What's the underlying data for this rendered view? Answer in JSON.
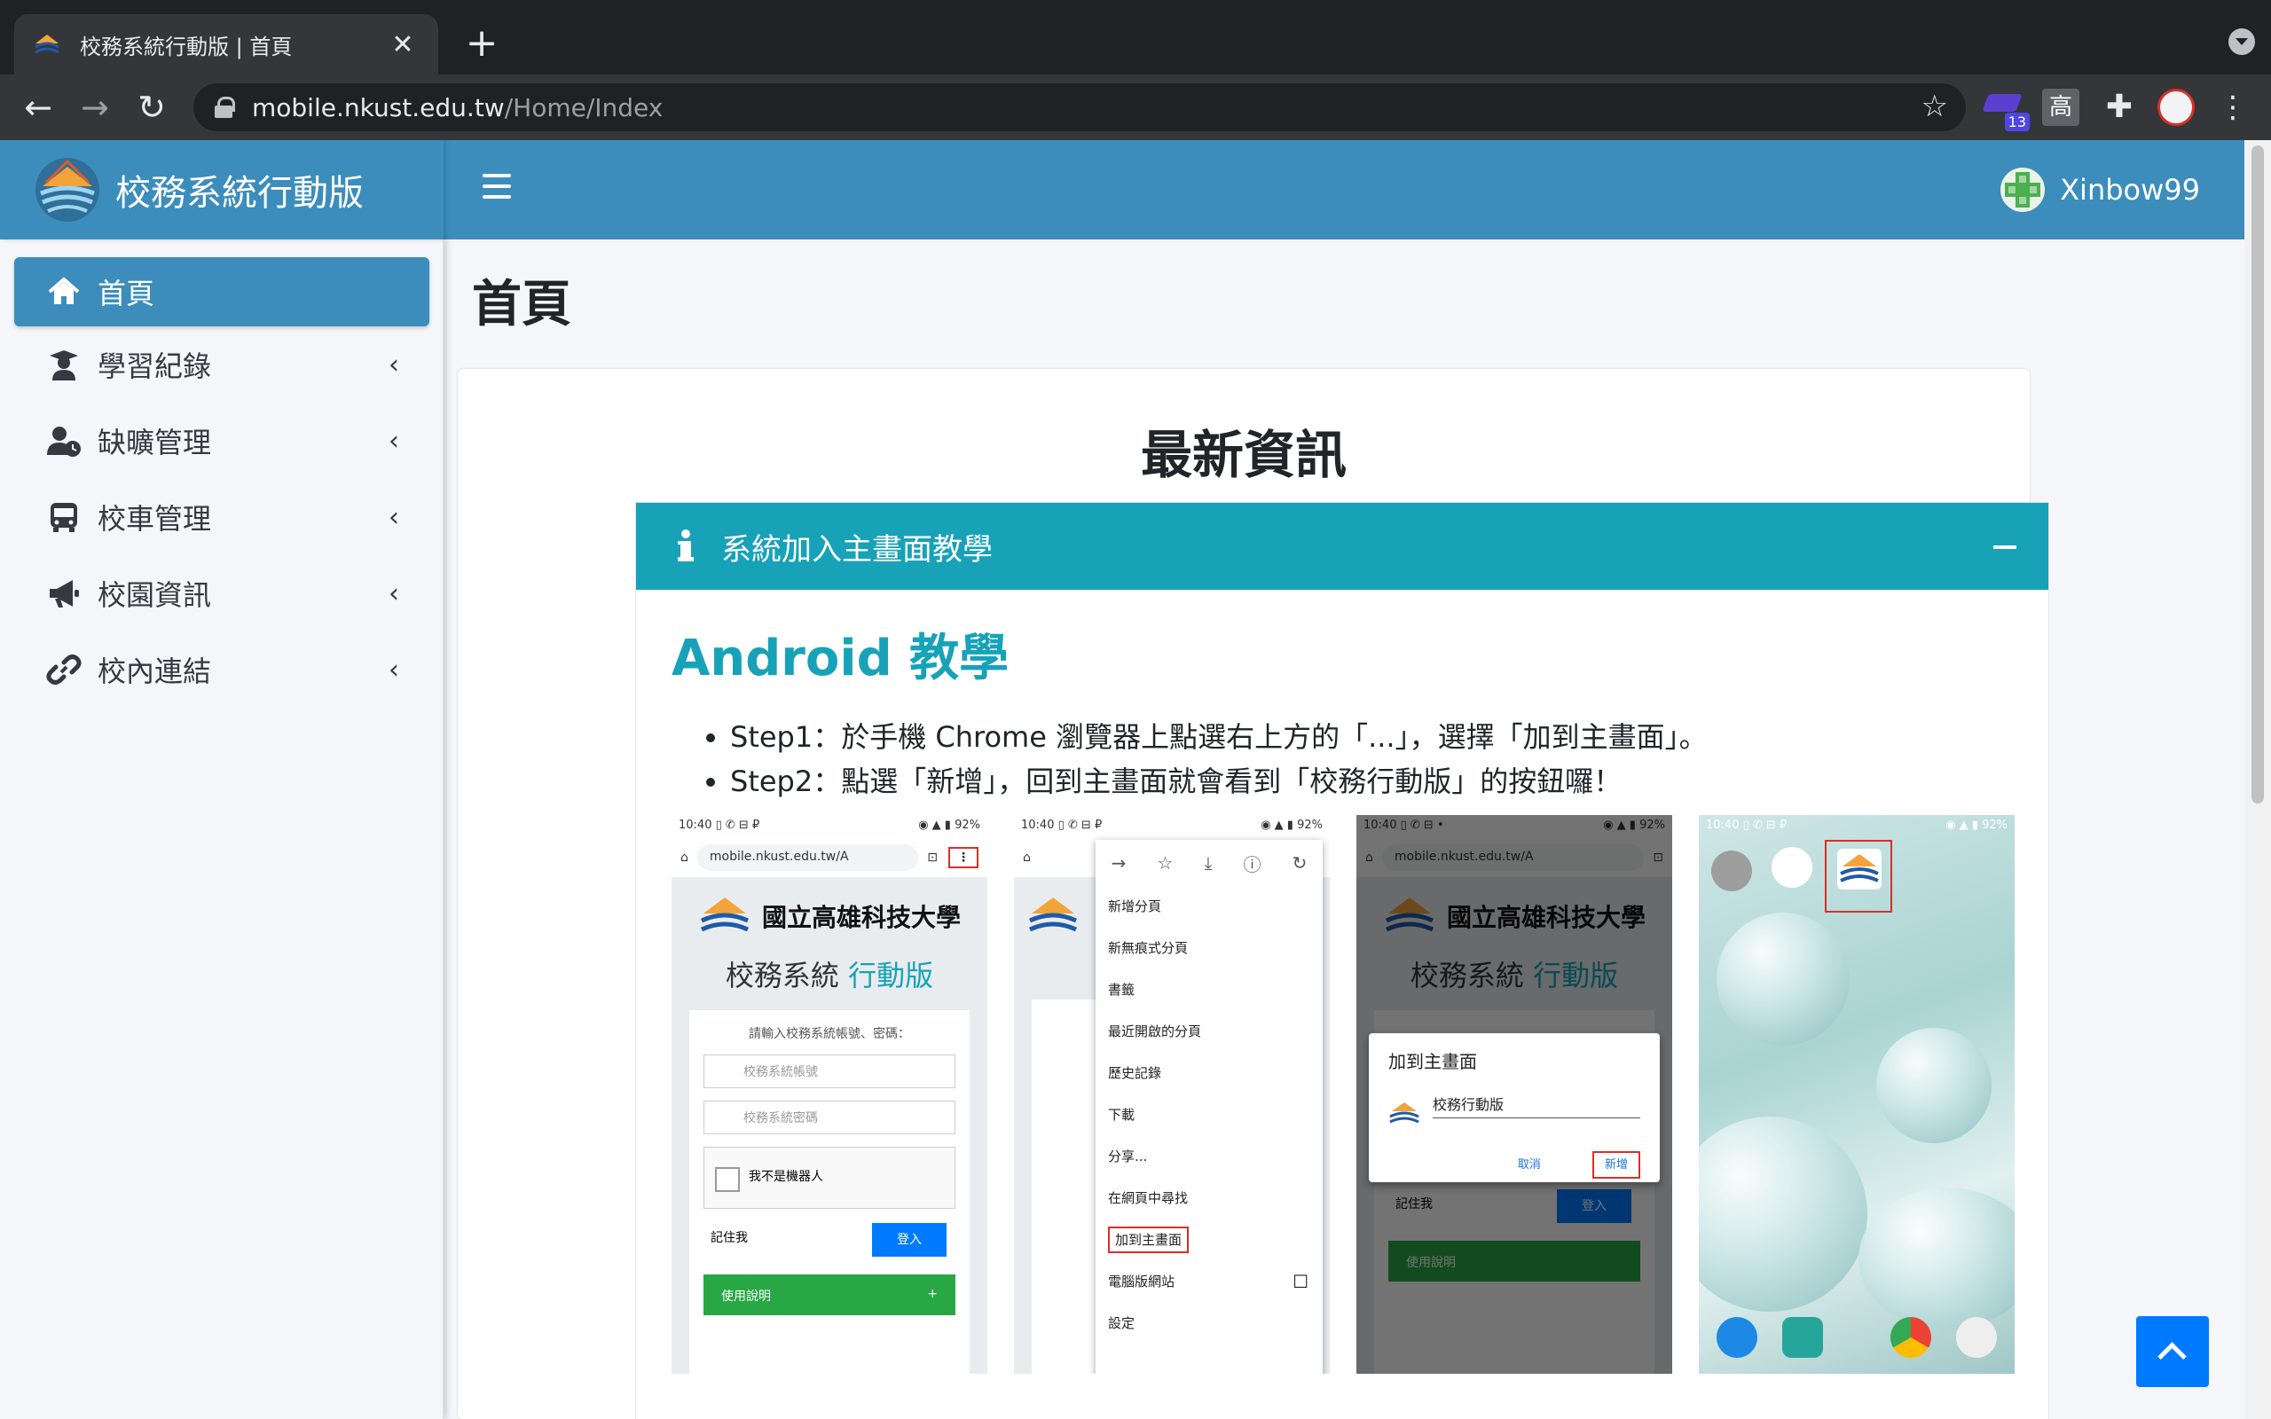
{
  "browser": {
    "tab_title": "校務系統行動版 | 首頁",
    "close_glyph": "✕",
    "new_tab_glyph": "+",
    "url_host": "mobile.nkust.edu.tw",
    "url_path": "/Home/Index",
    "ext_badge_count": "13",
    "ext_gao_label": "高",
    "back_glyph": "←",
    "forward_glyph": "→",
    "reload_glyph": "↻",
    "star_glyph": "☆",
    "menu_glyph": "⋮",
    "puzzle_glyph": "✚"
  },
  "app": {
    "brand": "校務系統行動版",
    "username": "Xinbow99",
    "accent": "#3c8dbc",
    "info_color": "#17a2b8"
  },
  "sidebar": {
    "items": [
      {
        "label": "首頁",
        "icon": "home-icon",
        "active": true
      },
      {
        "label": "學習紀錄",
        "icon": "graduate-icon"
      },
      {
        "label": "缺曠管理",
        "icon": "user-clock-icon"
      },
      {
        "label": "校車管理",
        "icon": "bus-icon"
      },
      {
        "label": "校園資訊",
        "icon": "megaphone-icon"
      },
      {
        "label": "校內連結",
        "icon": "link-icon"
      }
    ],
    "chevron": "‹"
  },
  "main": {
    "page_title": "首頁",
    "card_heading": "最新資訊",
    "panel_title": "系統加入主畫面教學",
    "android_title": "Android 教學",
    "steps": [
      "Step1：於手機 Chrome 瀏覽器上點選右上方的「...」，選擇「加到主畫面」。",
      "Step2：點選「新增」，回到主畫面就會看到「校務行動版」的按鈕囉！"
    ]
  },
  "screenshots": {
    "status_time": "10:40",
    "status_battery": "92%",
    "status_icons_left": "▯ ✆ ⊟ ₽",
    "status_icons_left_alt": "▯ ✆ ⊟ •",
    "status_icons_right": "◉ ▲ ▮",
    "home_glyph": "⌂",
    "tabs_glyph": "⊡",
    "mobile_url": "mobile.nkust.edu.tw/A",
    "school_name": "國立高雄科技大學",
    "system_name": "校務系統",
    "system_name_accent": "行動版",
    "login_hint": "請輸入校務系統帳號、密碼：",
    "account_placeholder": "校務系統帳號",
    "password_placeholder": "校務系統密碼",
    "captcha_label": "我不是機器人",
    "remember_label": "記住我",
    "login_button": "登入",
    "help_button": "使用說明",
    "help_plus": "+",
    "menu_icons": [
      "→",
      "☆",
      "⤓",
      "ⓘ",
      "↻"
    ],
    "menu_items": [
      "新增分頁",
      "新無痕式分頁",
      "書籤",
      "最近開啟的分頁",
      "歷史記錄",
      "下載",
      "分享...",
      "在網頁中尋找",
      "加到主畫面",
      "電腦版網站",
      "設定"
    ],
    "desktop_site_checkbox": "☐",
    "dialog_title": "加到主畫面",
    "dialog_app_name": "校務行動版",
    "dialog_cancel": "取消",
    "dialog_add": "新增"
  }
}
